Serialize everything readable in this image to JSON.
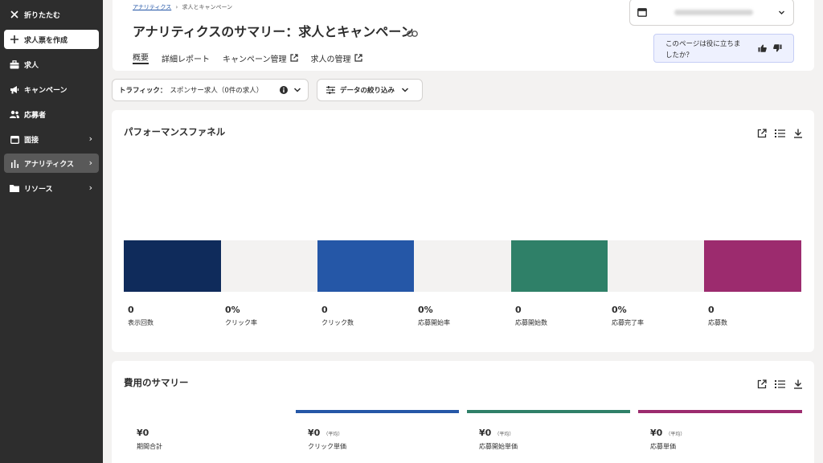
{
  "sidebar": {
    "collapse": "折りたたむ",
    "create": "求人票を作成",
    "items": [
      {
        "label": "求人",
        "icon": "briefcase-icon"
      },
      {
        "label": "キャンペーン",
        "icon": "megaphone-icon"
      },
      {
        "label": "応募者",
        "icon": "people-icon"
      },
      {
        "label": "面接",
        "icon": "calendar-icon"
      },
      {
        "label": "アナリティクス",
        "icon": "analytics-icon"
      },
      {
        "label": "リソース",
        "icon": "folder-icon"
      }
    ]
  },
  "header": {
    "breadcrumb": {
      "link": "アナリティクス",
      "separator": "›",
      "current": "求人とキャンペーン"
    },
    "title": "アナリティクスのサマリー：求人とキャンペーン",
    "tabs": [
      {
        "label": "概要",
        "active": true
      },
      {
        "label": "詳細レポート"
      },
      {
        "label": "キャンペーン管理",
        "external": true
      },
      {
        "label": "求人の管理",
        "external": true
      }
    ],
    "feedback": {
      "line1": "このページは役に立ちま",
      "line2": "したか？"
    }
  },
  "filters": {
    "traffic_label": "トラフィック：",
    "traffic_value": "スポンサー求人（0件の求人）",
    "refine": "データの絞り込み"
  },
  "funnel": {
    "title": "パフォーマンスファネル",
    "steps": [
      {
        "value": "0",
        "label": "表示回数",
        "color": "#0f2b5b",
        "kind": "bar"
      },
      {
        "value": "0%",
        "label": "クリック率",
        "kind": "rate"
      },
      {
        "value": "0",
        "label": "クリック数",
        "color": "#2557a7",
        "kind": "bar"
      },
      {
        "value": "0%",
        "label": "応募開始率",
        "kind": "rate"
      },
      {
        "value": "0",
        "label": "応募開始数",
        "color": "#2f8068",
        "kind": "bar"
      },
      {
        "value": "0%",
        "label": "応募完了率",
        "kind": "rate"
      },
      {
        "value": "0",
        "label": "応募数",
        "color": "#9c2b6e",
        "kind": "bar"
      }
    ]
  },
  "cost": {
    "title": "費用のサマリー",
    "items": [
      {
        "value": "¥0",
        "label": "期間合計",
        "sub": "",
        "color": ""
      },
      {
        "value": "¥0",
        "label": "クリック単価",
        "sub": "（平均）",
        "color": "#2557a7"
      },
      {
        "value": "¥0",
        "label": "応募開始単価",
        "sub": "（平均）",
        "color": "#2f8068"
      },
      {
        "value": "¥0",
        "label": "応募単価",
        "sub": "（平均）",
        "color": "#9c2b6e"
      }
    ]
  }
}
